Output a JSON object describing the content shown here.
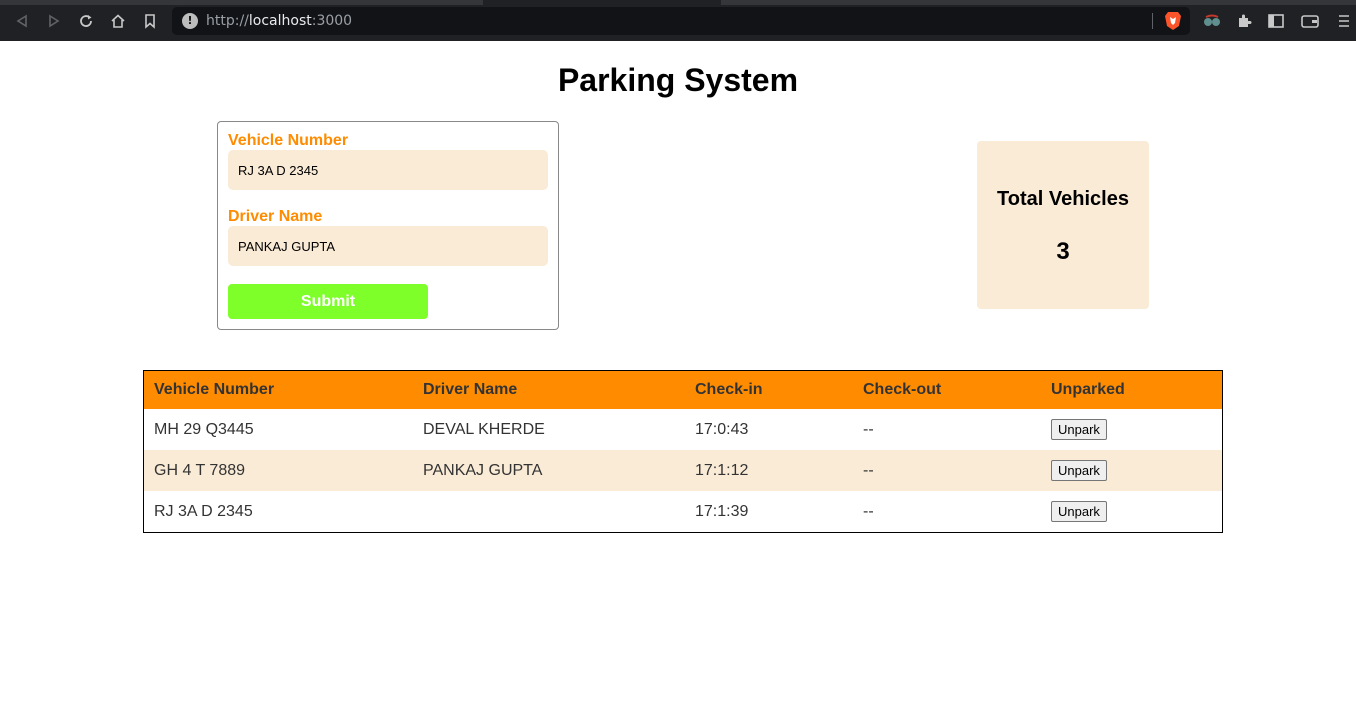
{
  "browser": {
    "url_scheme": "http://",
    "url_host": "localhost",
    "url_port": ":3000"
  },
  "page": {
    "title": "Parking System"
  },
  "form": {
    "vehicle_label": "Vehicle Number",
    "vehicle_value": "RJ 3A D 2345",
    "driver_label": "Driver Name",
    "driver_value": "PANKAJ GUPTA",
    "submit_label": "Submit"
  },
  "summary": {
    "label": "Total Vehicles",
    "count": "3"
  },
  "table": {
    "headers": [
      "Vehicle Number",
      "Driver Name",
      "Check-in",
      "Check-out",
      "Unparked"
    ],
    "rows": [
      {
        "vehicle": "MH 29 Q3445",
        "driver": "DEVAL KHERDE",
        "checkin": "17:0:43",
        "checkout": "--",
        "action": "Unpark"
      },
      {
        "vehicle": "GH 4 T 7889",
        "driver": "PANKAJ GUPTA",
        "checkin": "17:1:12",
        "checkout": "--",
        "action": "Unpark"
      },
      {
        "vehicle": "RJ 3A D 2345",
        "driver": "",
        "checkin": "17:1:39",
        "checkout": "--",
        "action": "Unpark"
      }
    ]
  },
  "colors": {
    "accent": "#ff8c00",
    "input_bg": "#faebd7",
    "submit_bg": "#7fff2a"
  }
}
